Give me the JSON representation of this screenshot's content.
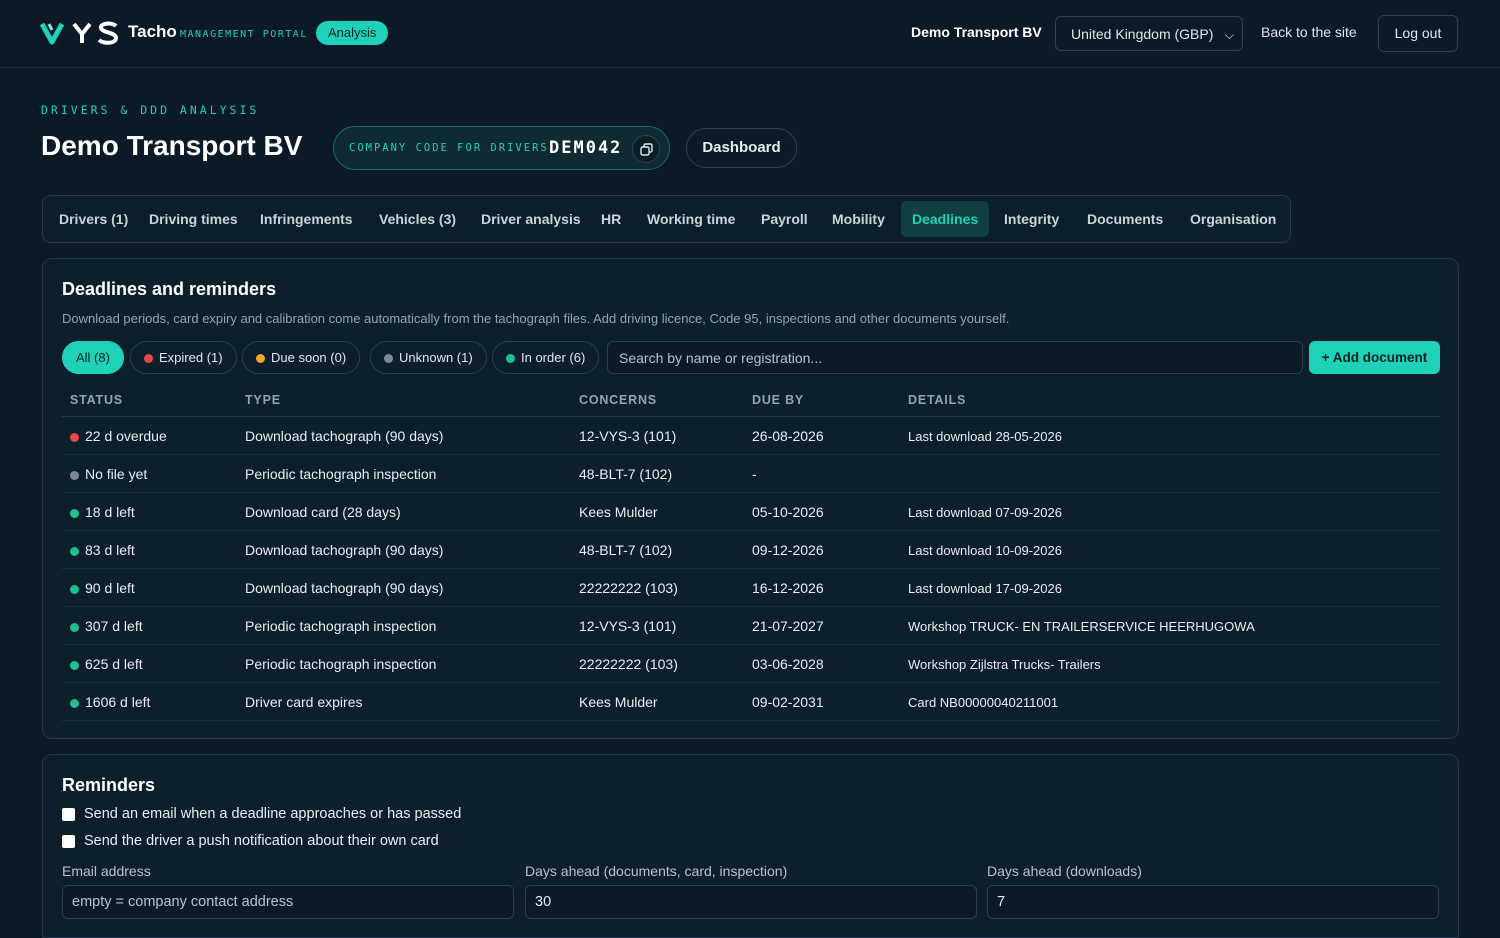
{
  "header": {
    "brand": "Tacho",
    "brand_sub": "MANAGEMENT PORTAL",
    "badge": "Analysis",
    "company": "Demo Transport BV",
    "region": "United Kingdom (GBP)",
    "back_link": "Back to the site",
    "logout": "Log out"
  },
  "page": {
    "eyebrow": "DRIVERS & DDD ANALYSIS",
    "title": "Demo Transport BV",
    "code_label": "COMPANY CODE FOR DRIVERS",
    "code_value": "DEM042",
    "dashboard_label": "Dashboard"
  },
  "tabs": [
    {
      "label": "Drivers (1)"
    },
    {
      "label": "Driving times"
    },
    {
      "label": "Infringements"
    },
    {
      "label": "Vehicles (3)"
    },
    {
      "label": "Driver analysis"
    },
    {
      "label": "HR"
    },
    {
      "label": "Working time"
    },
    {
      "label": "Payroll"
    },
    {
      "label": "Mobility"
    },
    {
      "label": "Deadlines"
    },
    {
      "label": "Integrity"
    },
    {
      "label": "Documents"
    },
    {
      "label": "Organisation"
    }
  ],
  "deadlines": {
    "title": "Deadlines and reminders",
    "description": "Download periods, card expiry and calibration come automatically from the tachograph files. Add driving licence, Code 95, inspections and other documents yourself.",
    "filters": [
      {
        "label": "All (8)"
      },
      {
        "label": "Expired (1)"
      },
      {
        "label": "Due soon (0)"
      },
      {
        "label": "Unknown (1)"
      },
      {
        "label": "In order (6)"
      }
    ],
    "search_placeholder": "Search by name or registration...",
    "add_label": "+ Add document",
    "columns": [
      "STATUS",
      "TYPE",
      "CONCERNS",
      "DUE BY",
      "DETAILS"
    ],
    "rows": [
      {
        "status": "22 d overdue",
        "type": "Download tachograph (90 days)",
        "concerns": "12-VYS-3 (101)",
        "due": "26-08-2026",
        "details": "Last download 28-05-2026"
      },
      {
        "status": "No file yet",
        "type": "Periodic tachograph inspection",
        "concerns": "48-BLT-7 (102)",
        "due": "-",
        "details": ""
      },
      {
        "status": "18 d left",
        "type": "Download card (28 days)",
        "concerns": "Kees Mulder",
        "due": "05-10-2026",
        "details": "Last download 07-09-2026"
      },
      {
        "status": "83 d left",
        "type": "Download tachograph (90 days)",
        "concerns": "48-BLT-7 (102)",
        "due": "09-12-2026",
        "details": "Last download 10-09-2026"
      },
      {
        "status": "90 d left",
        "type": "Download tachograph (90 days)",
        "concerns": "22222222 (103)",
        "due": "16-12-2026",
        "details": "Last download 17-09-2026"
      },
      {
        "status": "307 d left",
        "type": "Periodic tachograph inspection",
        "concerns": "12-VYS-3 (101)",
        "due": "21-07-2027",
        "details": "Workshop TRUCK- EN TRAILERSERVICE HEERHUGOWA"
      },
      {
        "status": "625 d left",
        "type": "Periodic tachograph inspection",
        "concerns": "22222222 (103)",
        "due": "03-06-2028",
        "details": "Workshop Zijlstra Trucks- Trailers"
      },
      {
        "status": "1606 d left",
        "type": "Driver card expires",
        "concerns": "Kees Mulder",
        "due": "09-02-2031",
        "details": "Card NB00000040211001"
      }
    ]
  },
  "reminders": {
    "title": "Reminders",
    "opt_email": "Send an email when a deadline approaches or has passed",
    "opt_push": "Send the driver a push notification about their own card",
    "email_label": "Email address",
    "email_placeholder": "empty = company contact address",
    "days_docs_label": "Days ahead (documents, card, inspection)",
    "days_docs_value": "30",
    "days_dl_label": "Days ahead (downloads)",
    "days_dl_value": "7"
  },
  "colors": {
    "accent": "#1fd1b8",
    "expired": "#e5484d",
    "due_soon": "#f5a524",
    "unknown": "#7b8a96",
    "ok": "#1fbf8f",
    "background": "#0b1a26"
  }
}
